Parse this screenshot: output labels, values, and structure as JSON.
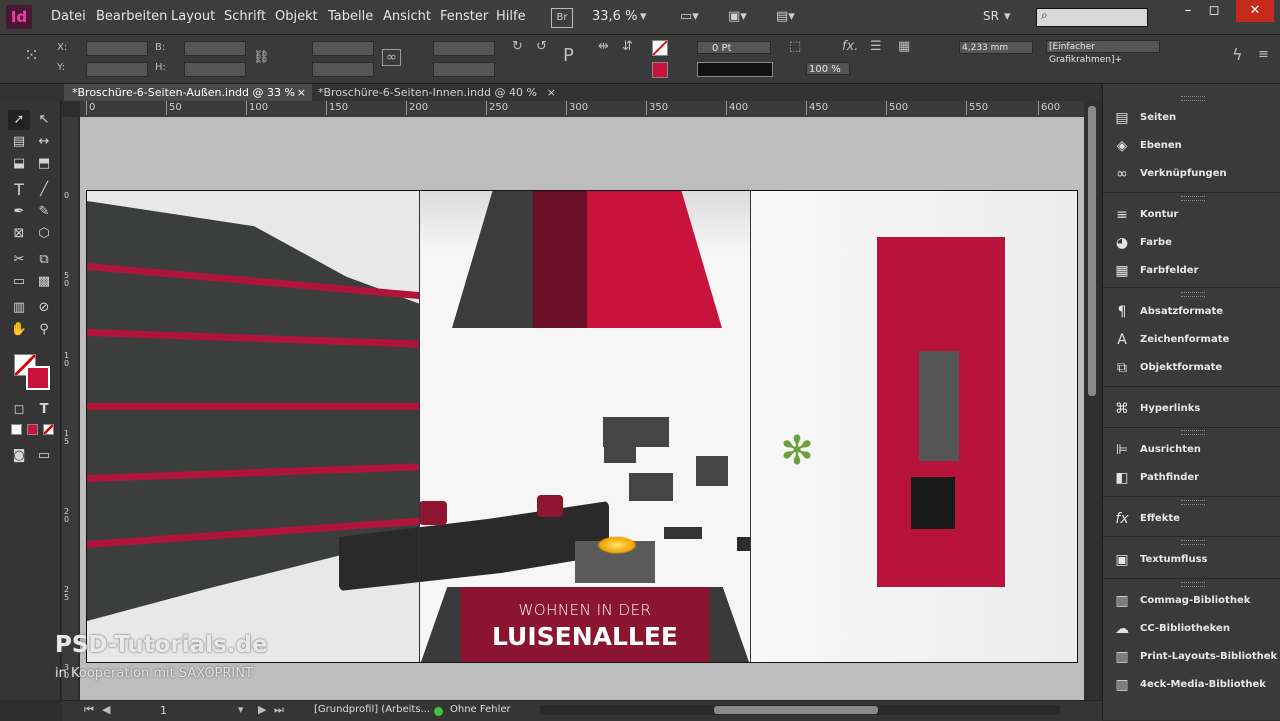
{
  "app": {
    "logo": "Id"
  },
  "menu": [
    "Datei",
    "Bearbeiten",
    "Layout",
    "Schrift",
    "Objekt",
    "Tabelle",
    "Ansicht",
    "Fenster",
    "Hilfe"
  ],
  "menu_extra": {
    "bridge": "Br",
    "zoom": "33,6 %",
    "workspace": "SR"
  },
  "window_controls": {
    "minimize": "–",
    "maximize": "◻",
    "close": "✕"
  },
  "control": {
    "x_label": "X:",
    "y_label": "Y:",
    "w_label": "B:",
    "h_label": "H:",
    "stroke_weight": "0 Pt",
    "opacity": "100 %",
    "frame_width": "4,233 mm",
    "object_style": "[Einfacher Grafikrahmen]+"
  },
  "tabs": [
    {
      "label": "*Broschüre-6-Seiten-Außen.indd @ 33 %",
      "close": "×"
    },
    {
      "label": "*Broschüre-6-Seiten-Innen.indd @ 40 %",
      "close": "×"
    }
  ],
  "ruler": [
    "0",
    "50",
    "100",
    "150",
    "200",
    "250",
    "300",
    "350",
    "400",
    "450",
    "500",
    "550",
    "600"
  ],
  "vruler": [
    "0",
    "5",
    "0",
    "1",
    "0",
    "1",
    "5",
    "0",
    "2",
    "0",
    "2",
    "5",
    "0",
    "3"
  ],
  "poster": {
    "line1": "WOHNEN IN DER",
    "line2": "LUISENALLEE"
  },
  "watermark": {
    "brand": "PSD-Tutorials.de",
    "sub": "in Kooperation mit SAXOPRINT"
  },
  "status": {
    "page": "1",
    "profile": "[Grundprofil] (Arbeits...",
    "errors": "Ohne Fehler"
  },
  "panels": [
    {
      "label": "Seiten",
      "icon": "pages-icon"
    },
    {
      "label": "Ebenen",
      "icon": "layers-icon"
    },
    {
      "label": "Verknüpfungen",
      "icon": "links-icon"
    },
    {
      "label": "Kontur",
      "icon": "stroke-icon"
    },
    {
      "label": "Farbe",
      "icon": "color-icon"
    },
    {
      "label": "Farbfelder",
      "icon": "swatches-icon"
    },
    {
      "label": "Absatzformate",
      "icon": "paragraph-styles-icon"
    },
    {
      "label": "Zeichenformate",
      "icon": "character-styles-icon"
    },
    {
      "label": "Objektformate",
      "icon": "object-styles-icon"
    },
    {
      "label": "Hyperlinks",
      "icon": "hyperlinks-icon"
    },
    {
      "label": "Ausrichten",
      "icon": "align-icon"
    },
    {
      "label": "Pathfinder",
      "icon": "pathfinder-icon"
    },
    {
      "label": "Effekte",
      "icon": "effects-icon"
    },
    {
      "label": "Textumfluss",
      "icon": "text-wrap-icon"
    },
    {
      "label": "Commag-Bibliothek",
      "icon": "library-icon"
    },
    {
      "label": "CC-Bibliotheken",
      "icon": "cc-libraries-icon"
    },
    {
      "label": "Print-Layouts-Bibliothek",
      "icon": "library-icon"
    },
    {
      "label": "4eck-Media-Bibliothek",
      "icon": "library-icon"
    }
  ],
  "colors": {
    "accent": "#c8143c",
    "dark": "#3a3a3a",
    "panel": "#3a3a3a"
  }
}
